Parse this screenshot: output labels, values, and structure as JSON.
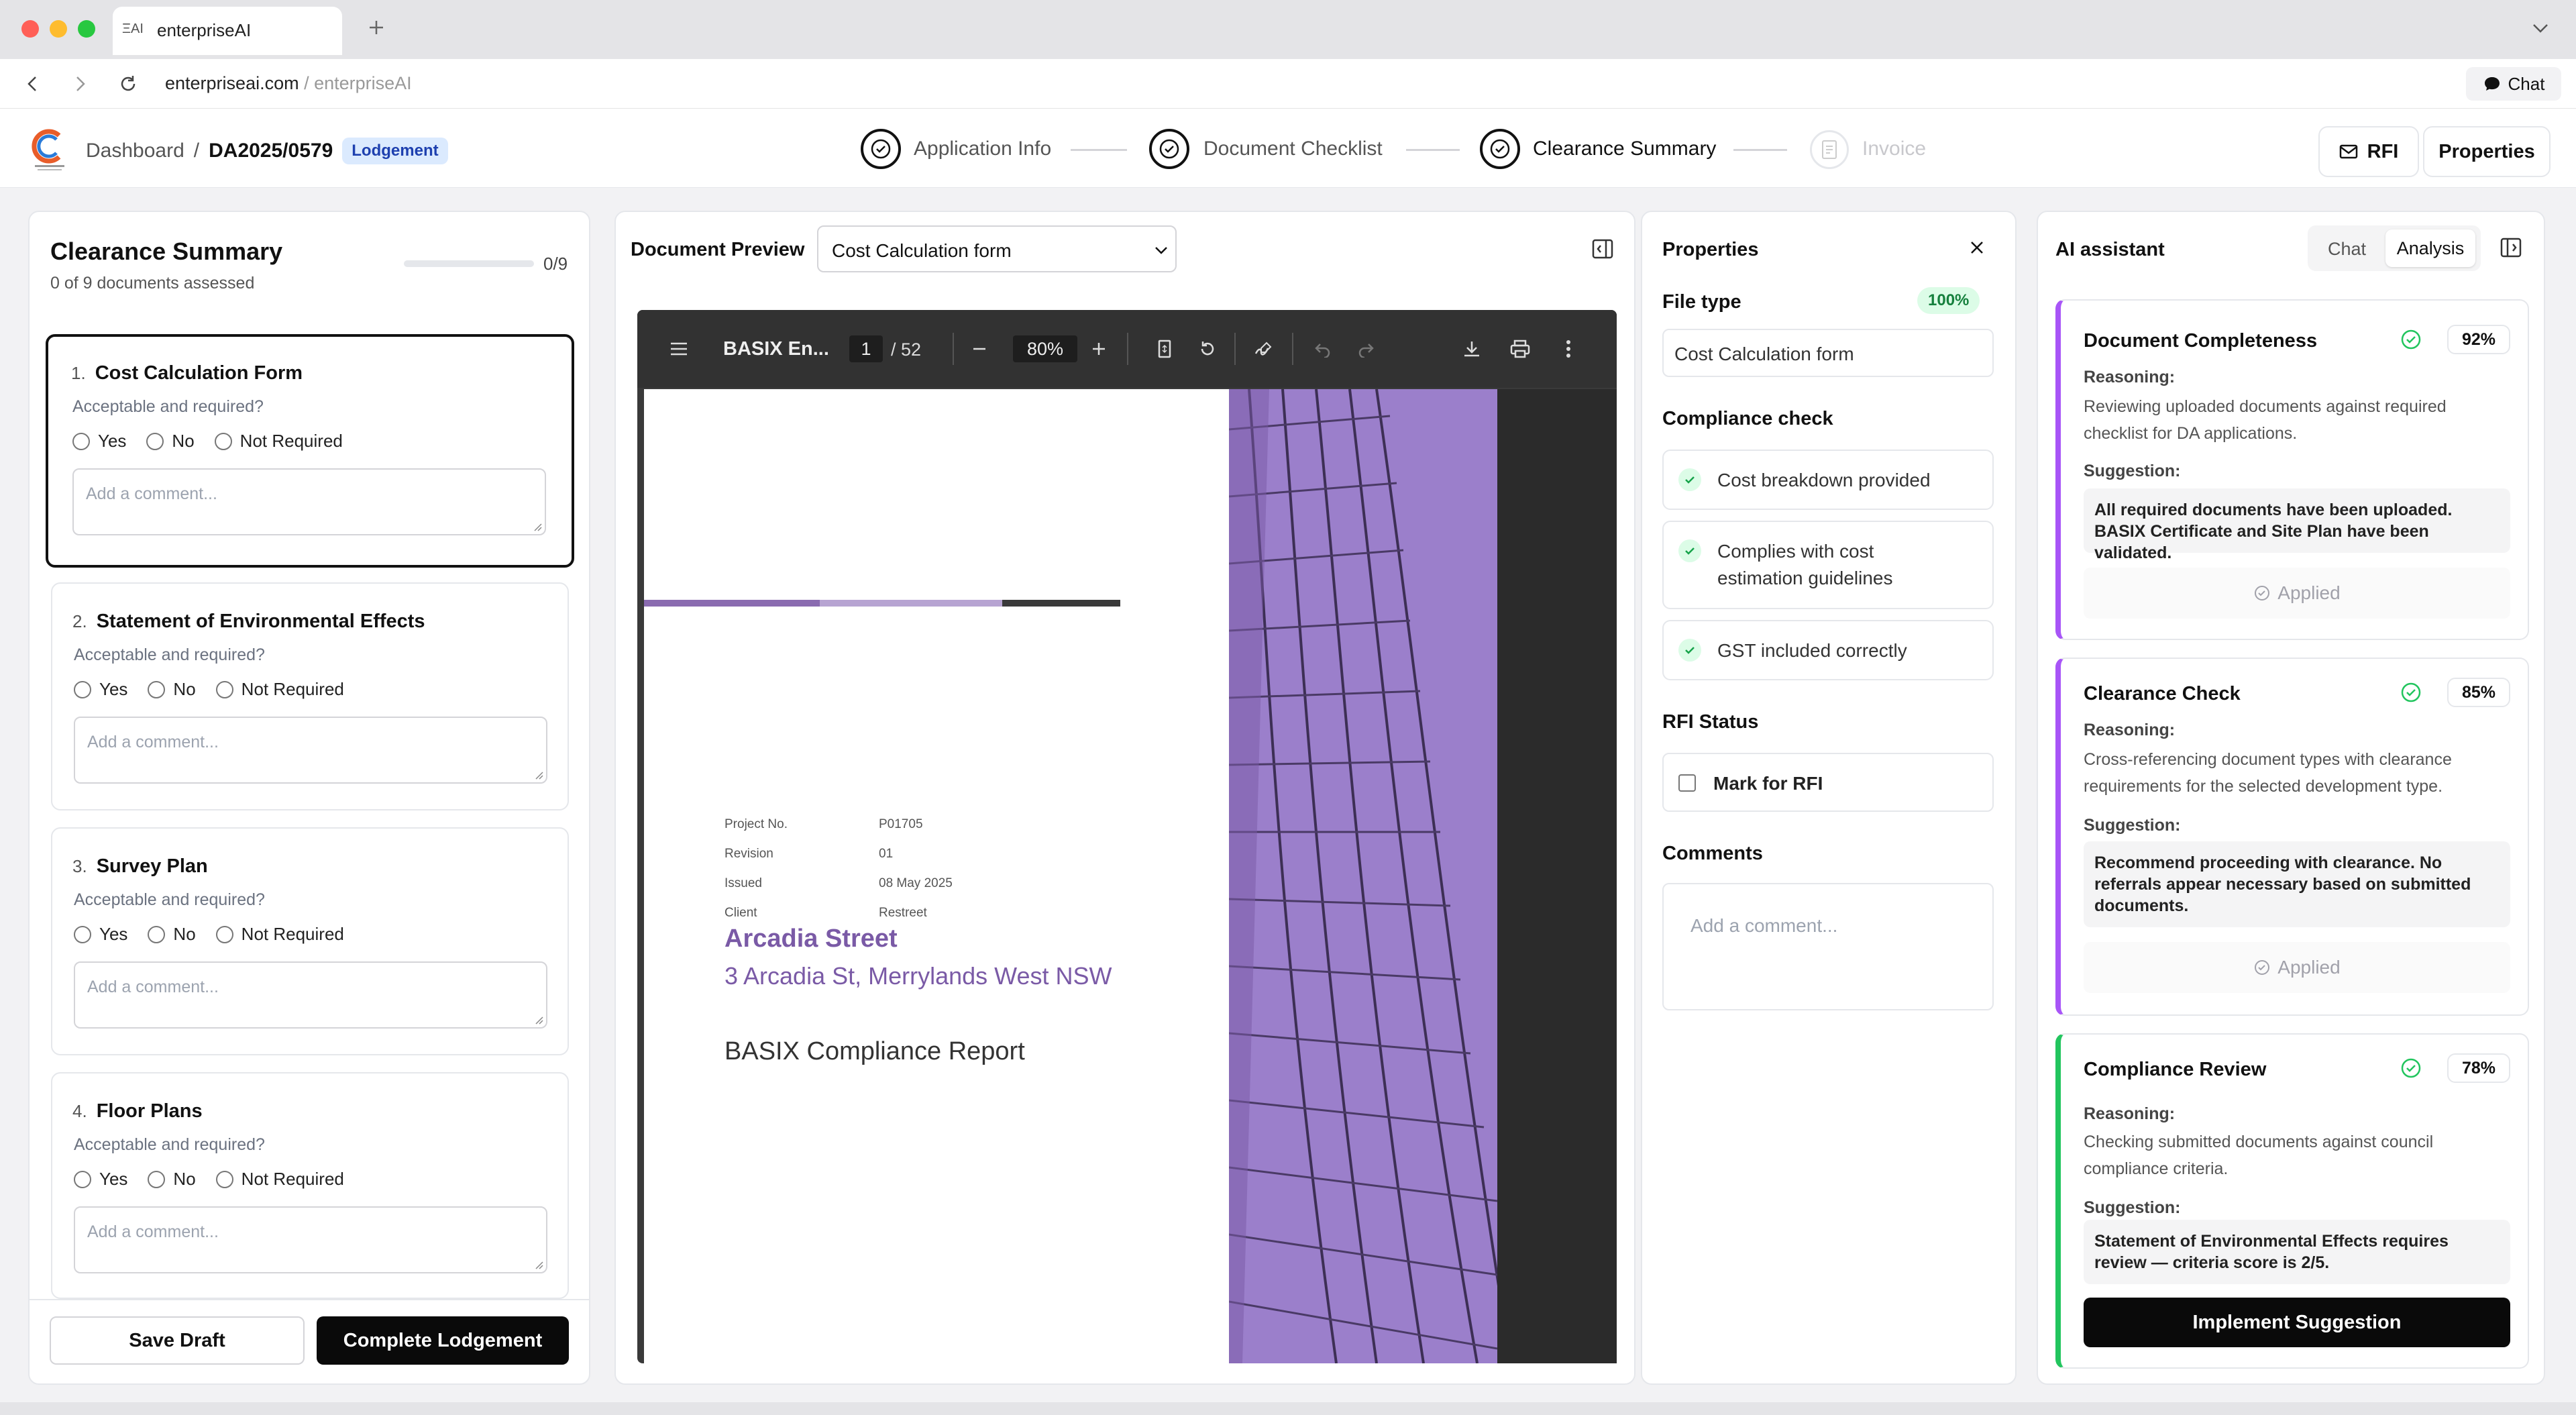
{
  "browser": {
    "tab_title": "enterpriseAI",
    "tab_logo": "ΞAI",
    "url_domain": "enterpriseai.com",
    "url_path": " / enterpriseAI",
    "chat_label": "Chat"
  },
  "header": {
    "breadcrumb_root": "Dashboard",
    "separator": "/",
    "app_id": "DA2025/0579",
    "status_badge": "Lodgement",
    "steps": [
      {
        "label": "Application Info",
        "state": "done"
      },
      {
        "label": "Document Checklist",
        "state": "done"
      },
      {
        "label": "Clearance Summary",
        "state": "current"
      },
      {
        "label": "Invoice",
        "state": "disabled"
      }
    ],
    "rfi_label": "RFI",
    "properties_label": "Properties"
  },
  "clearance": {
    "title": "Clearance Summary",
    "subtitle": "0 of 9 documents assessed",
    "progress_text": "0/9",
    "progress_value": 0,
    "question": "Acceptable and required?",
    "options": [
      "Yes",
      "No",
      "Not Required"
    ],
    "comment_placeholder": "Add a comment...",
    "items": [
      {
        "num": "1.",
        "title": "Cost Calculation Form"
      },
      {
        "num": "2.",
        "title": "Statement of Environmental Effects"
      },
      {
        "num": "3.",
        "title": "Survey Plan"
      },
      {
        "num": "4.",
        "title": "Floor Plans"
      }
    ],
    "save_draft": "Save Draft",
    "complete": "Complete Lodgement"
  },
  "preview": {
    "label": "Document Preview",
    "selected_doc": "Cost Calculation form",
    "toolbar": {
      "doc_title": "BASIX En...",
      "page": "1",
      "page_total": "/ 52",
      "zoom": "80%"
    },
    "pdf": {
      "street": "Arcadia Street",
      "address": "3 Arcadia St, Merrylands West NSW",
      "report": "BASIX Compliance Report",
      "meta": [
        {
          "k": "Project No.",
          "v": "P01705"
        },
        {
          "k": "Revision",
          "v": "01"
        },
        {
          "k": "Issued",
          "v": "08 May 2025"
        },
        {
          "k": "Client",
          "v": "Restreet"
        }
      ]
    }
  },
  "properties": {
    "title": "Properties",
    "file_type_label": "File type",
    "file_type_badge": "100%",
    "file_type_value": "Cost Calculation form",
    "compliance_label": "Compliance check",
    "checks": [
      "Cost breakdown provided",
      "Complies with cost estimation guidelines",
      "GST included correctly"
    ],
    "rfi_label": "RFI Status",
    "rfi_checkbox": "Mark for RFI",
    "comments_label": "Comments",
    "comments_placeholder": "Add a comment..."
  },
  "ai": {
    "title": "AI assistant",
    "tabs": [
      "Chat",
      "Analysis"
    ],
    "active_tab": "Analysis",
    "reasoning_label": "Reasoning:",
    "suggestion_label": "Suggestion:",
    "applied_label": "Applied",
    "implement_label": "Implement Suggestion",
    "cards": [
      {
        "title": "Document Completeness",
        "pct": "92%",
        "reasoning": "Reviewing uploaded documents against required checklist for DA applications.",
        "suggestion": "All required documents have been uploaded. BASIX Certificate and Site Plan have been validated.",
        "accent": "#a855f7"
      },
      {
        "title": "Clearance Check",
        "pct": "85%",
        "reasoning": "Cross-referencing document types with clearance requirements for the selected development type.",
        "suggestion": "Recommend proceeding with clearance. No referrals appear necessary based on submitted documents.",
        "accent": "#a855f7"
      },
      {
        "title": "Compliance Review",
        "pct": "78%",
        "reasoning": "Checking submitted documents against council compliance criteria.",
        "suggestion": "Statement of Environmental Effects requires review — criteria score is 2/5.",
        "accent": "#22c55e"
      }
    ]
  },
  "colors": {
    "badge_bg": "#dbeafe",
    "badge_text": "#1e40af",
    "success": "#22c55e",
    "purple_accent": "#a855f7",
    "pdf_purple": "#8a6bb0"
  }
}
